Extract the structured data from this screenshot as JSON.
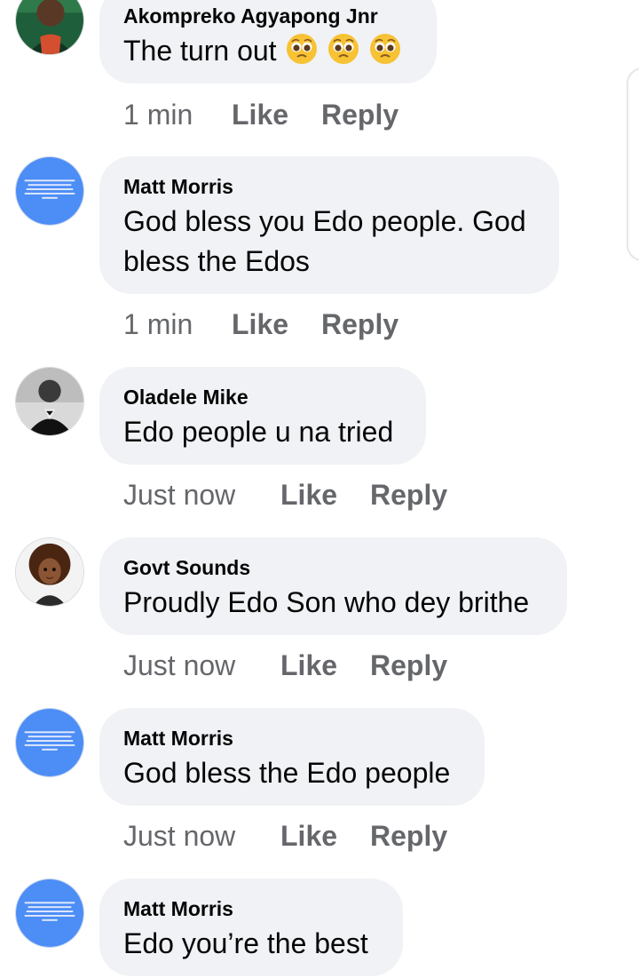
{
  "comments": [
    {
      "name": "Akompreko Agyapong Jnr",
      "text": "The turn out",
      "emoji": [
        "pleading-face-icon",
        "pleading-face-icon",
        "pleading-face-icon"
      ],
      "time": "1 min",
      "like": "Like",
      "reply": "Reply",
      "avatar": "avatar-photo-man-green"
    },
    {
      "name": "Matt Morris",
      "text_lines": [
        "God bless you Edo people. God",
        "bless the Edos"
      ],
      "time": "1 min",
      "like": "Like",
      "reply": "Reply",
      "avatar": "avatar-blue-text"
    },
    {
      "name": "Oladele Mike",
      "text": "Edo people u na tried",
      "time": "Just now",
      "like": "Like",
      "reply": "Reply",
      "avatar": "avatar-photo-man-bw"
    },
    {
      "name": "Govt Sounds",
      "text": "Proudly Edo Son who dey brithe",
      "time": "Just now",
      "like": "Like",
      "reply": "Reply",
      "avatar": "avatar-cartoon-afro"
    },
    {
      "name": "Matt Morris",
      "text": "God bless the Edo people",
      "time": "Just now",
      "like": "Like",
      "reply": "Reply",
      "avatar": "avatar-blue-text"
    },
    {
      "name": "Matt Morris",
      "text": "Edo you’re the best",
      "avatar": "avatar-blue-text"
    }
  ],
  "colors": {
    "bubble": "#f0f2f5",
    "meta_text": "#65676b",
    "avatar_blue": "#4c8df6",
    "text": "#050505"
  }
}
